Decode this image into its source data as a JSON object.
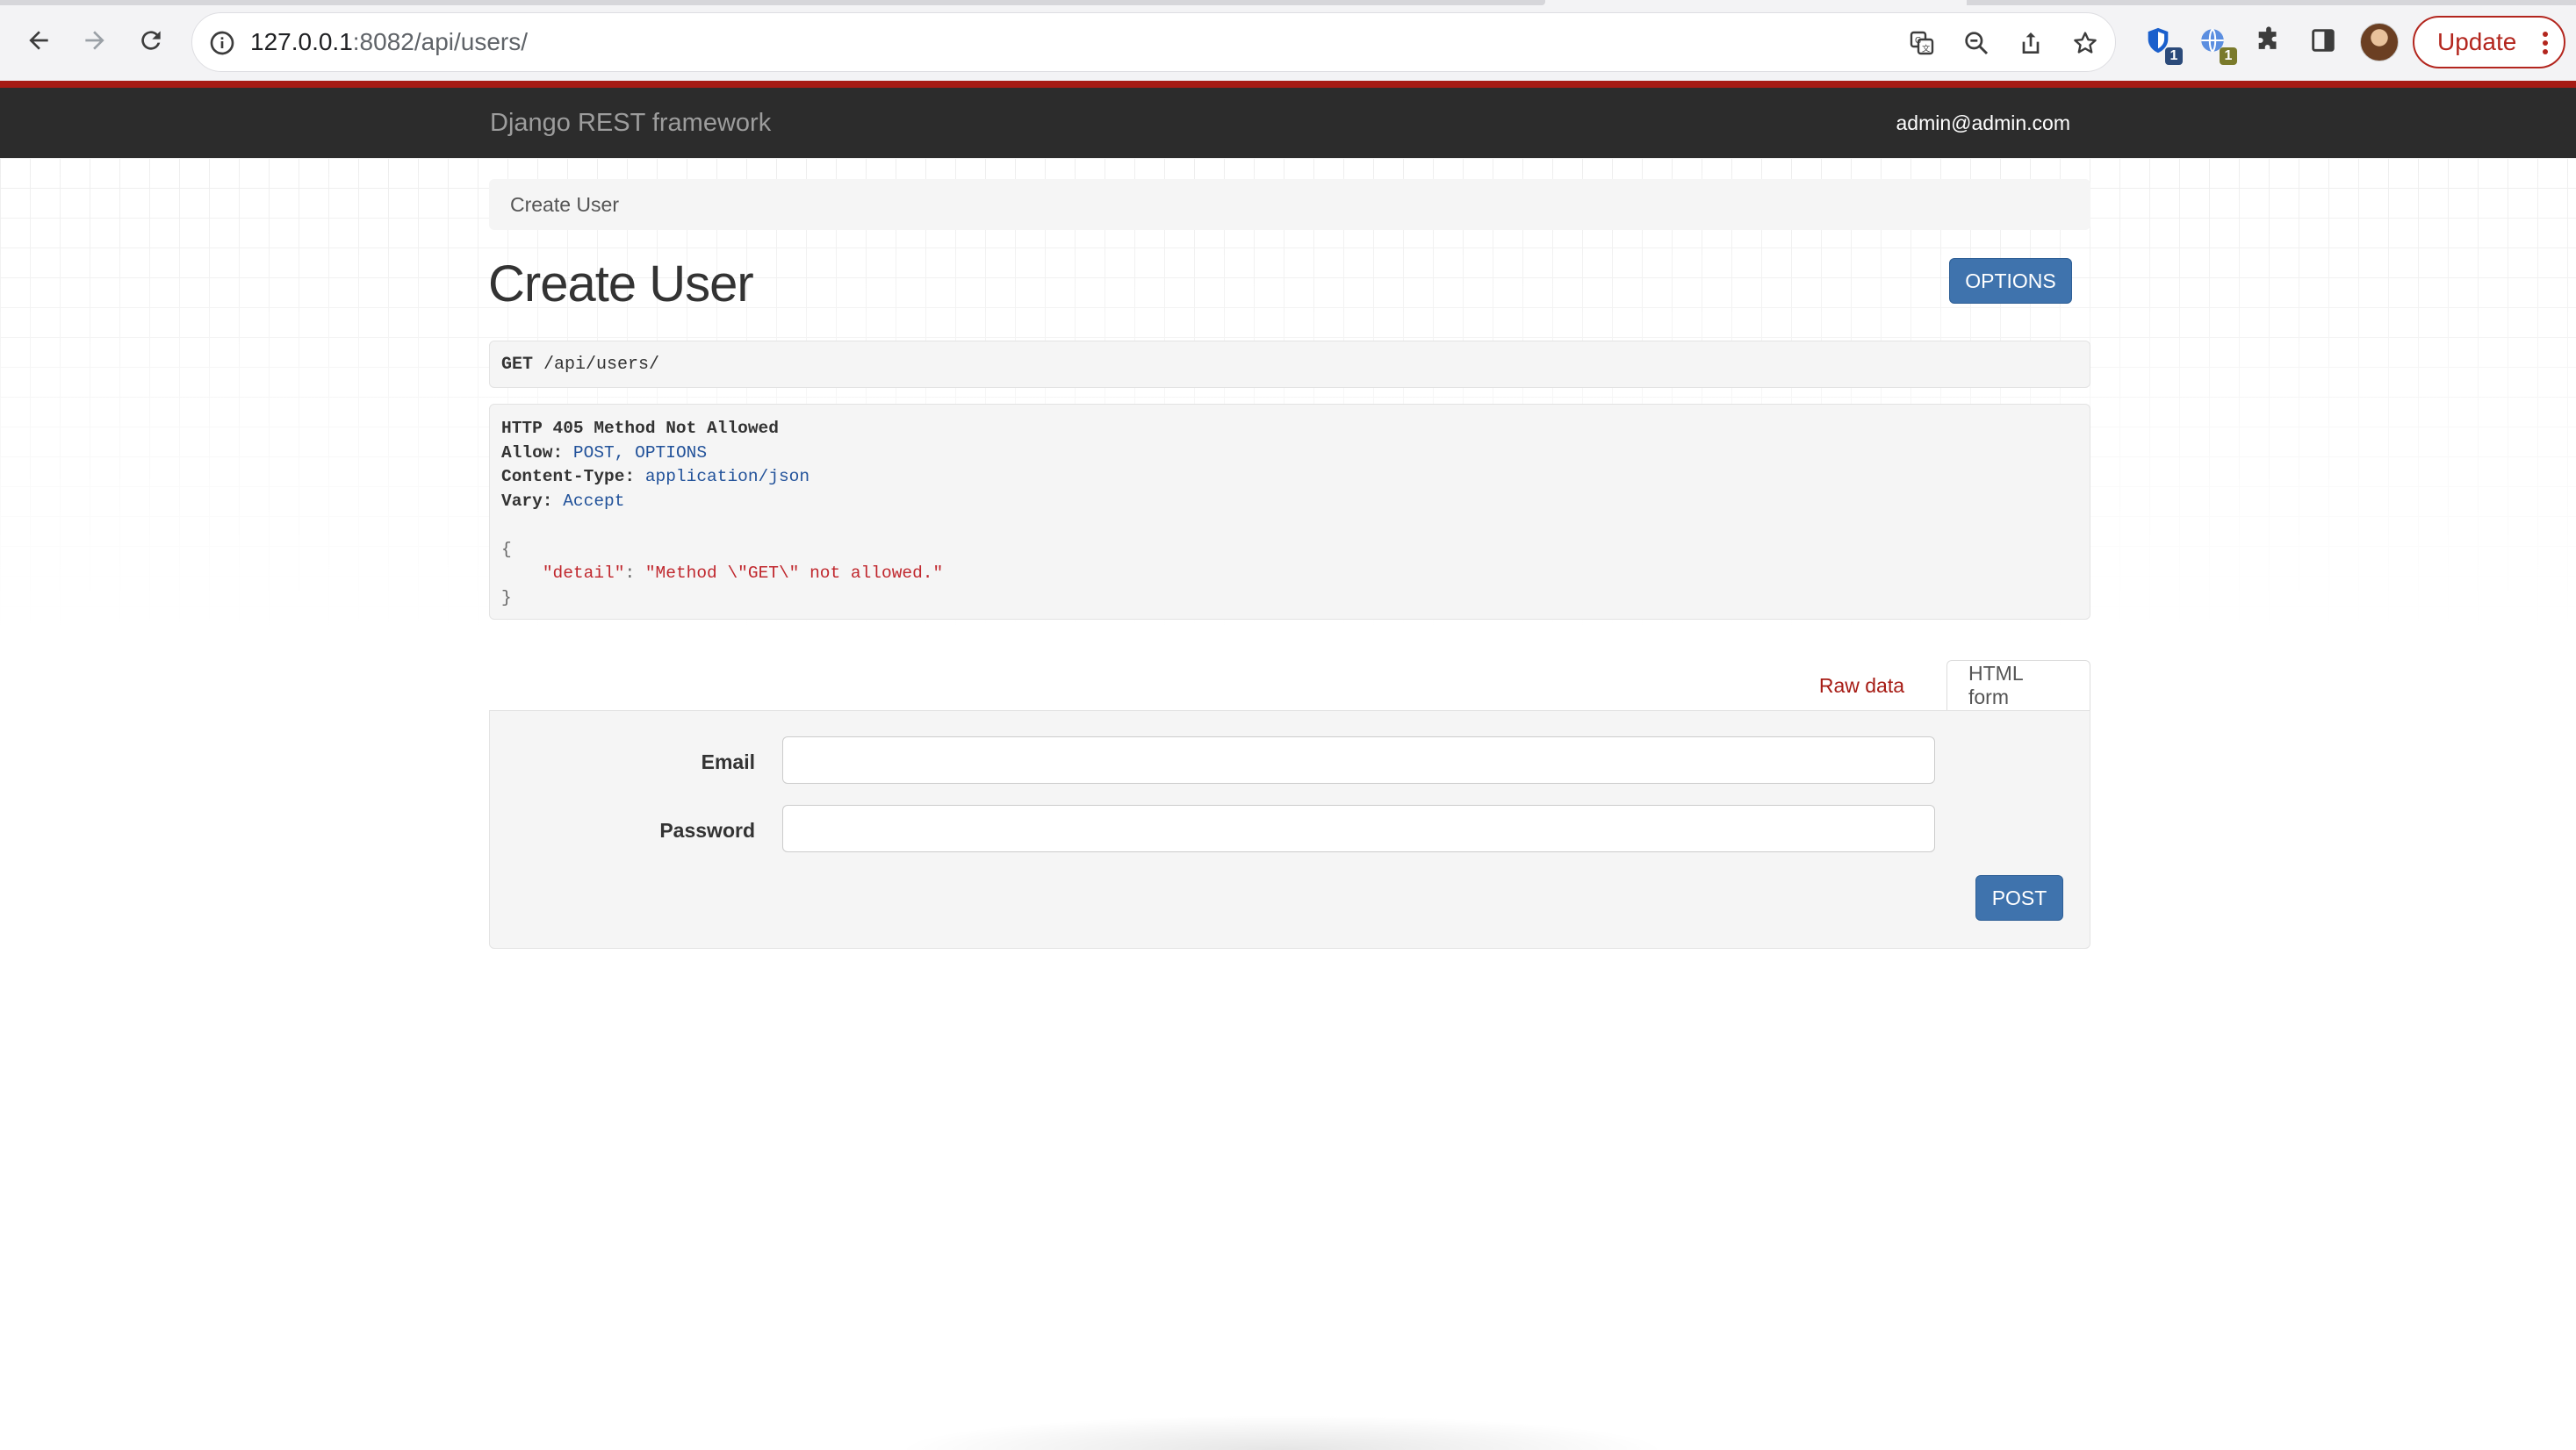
{
  "browser": {
    "url_host": "127.0.0.1",
    "url_rest": ":8082/api/users/",
    "update_label": "Update",
    "extension_badges": [
      "1",
      "1"
    ]
  },
  "navbar": {
    "brand": "Django REST framework",
    "user_email": "admin@admin.com"
  },
  "breadcrumb": "Create User",
  "page_title": "Create User",
  "options_label": "OPTIONS",
  "request": {
    "method": "GET",
    "path": "/api/users/"
  },
  "response": {
    "status_line": "HTTP 405 Method Not Allowed",
    "headers": [
      {
        "name": "Allow:",
        "value": "POST, OPTIONS"
      },
      {
        "name": "Content-Type:",
        "value": "application/json"
      },
      {
        "name": "Vary:",
        "value": "Accept"
      }
    ],
    "body_open": "{",
    "body_key": "\"detail\"",
    "body_sep": ": ",
    "body_value": "\"Method \\\"GET\\\" not allowed.\"",
    "body_close": "}"
  },
  "tabs": {
    "raw": "Raw data",
    "html": "HTML form"
  },
  "form": {
    "email_label": "Email",
    "email_value": "",
    "password_label": "Password",
    "password_value": "",
    "submit_label": "POST"
  },
  "colors": {
    "navbar_bg": "#2c2c2c",
    "navbar_accent": "#a61b14",
    "primary_button": "#3f73ad",
    "update_red": "#b3261e"
  }
}
